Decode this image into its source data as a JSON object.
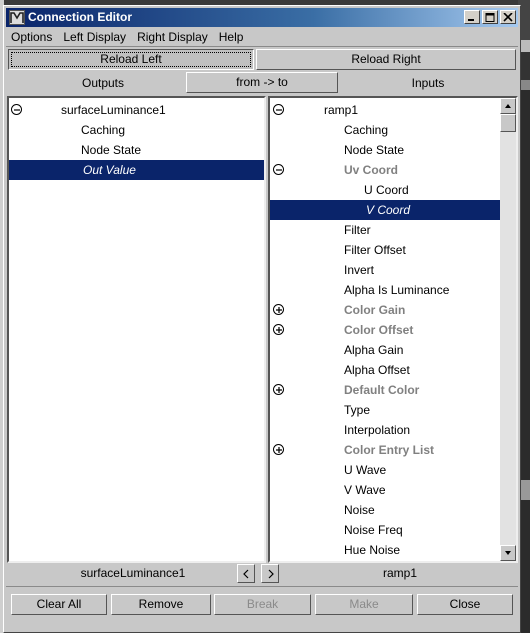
{
  "window": {
    "title": "Connection Editor"
  },
  "menu": [
    "Options",
    "Left Display",
    "Right Display",
    "Help"
  ],
  "buttons": {
    "reload_left": "Reload Left",
    "reload_right": "Reload Right",
    "from_to": "from -> to",
    "clear_all": "Clear All",
    "remove": "Remove",
    "break": "Break",
    "make": "Make",
    "close": "Close"
  },
  "headers": {
    "outputs": "Outputs",
    "inputs": "Inputs"
  },
  "left_panel": {
    "items": [
      {
        "label": "surfaceLuminance1",
        "expander": "minus"
      },
      {
        "label": "Caching"
      },
      {
        "label": "Node State"
      },
      {
        "label": "Out Value",
        "selected": true
      }
    ]
  },
  "right_panel": {
    "items": [
      {
        "label": "ramp1",
        "expander": "minus"
      },
      {
        "label": "Caching"
      },
      {
        "label": "Node State"
      },
      {
        "label": "Uv Coord",
        "expander": "minus",
        "greyed": true
      },
      {
        "label": "U Coord"
      },
      {
        "label": "V Coord",
        "selected": true
      },
      {
        "label": "Filter"
      },
      {
        "label": "Filter Offset"
      },
      {
        "label": "Invert"
      },
      {
        "label": "Alpha Is Luminance"
      },
      {
        "label": "Color Gain",
        "expander": "plus",
        "greyed": true
      },
      {
        "label": "Color Offset",
        "expander": "plus",
        "greyed": true
      },
      {
        "label": "Alpha Gain"
      },
      {
        "label": "Alpha Offset"
      },
      {
        "label": "Default Color",
        "expander": "plus",
        "greyed": true
      },
      {
        "label": "Type"
      },
      {
        "label": "Interpolation"
      },
      {
        "label": "Color Entry List",
        "expander": "plus",
        "greyed": true
      },
      {
        "label": "U Wave"
      },
      {
        "label": "V Wave"
      },
      {
        "label": "Noise"
      },
      {
        "label": "Noise Freq"
      },
      {
        "label": "Hue Noise"
      }
    ]
  },
  "footer": {
    "left_node": "surfaceLuminance1",
    "right_node": "ramp1"
  },
  "icons": {
    "prev": "chevron-left-icon",
    "next": "chevron-right-icon",
    "expand": "plus-circle-icon",
    "collapse": "minus-circle-icon"
  },
  "colors": {
    "title_bar": "#0a246a",
    "selection": "#0a246a",
    "window_bg": "#c8c8c8"
  }
}
